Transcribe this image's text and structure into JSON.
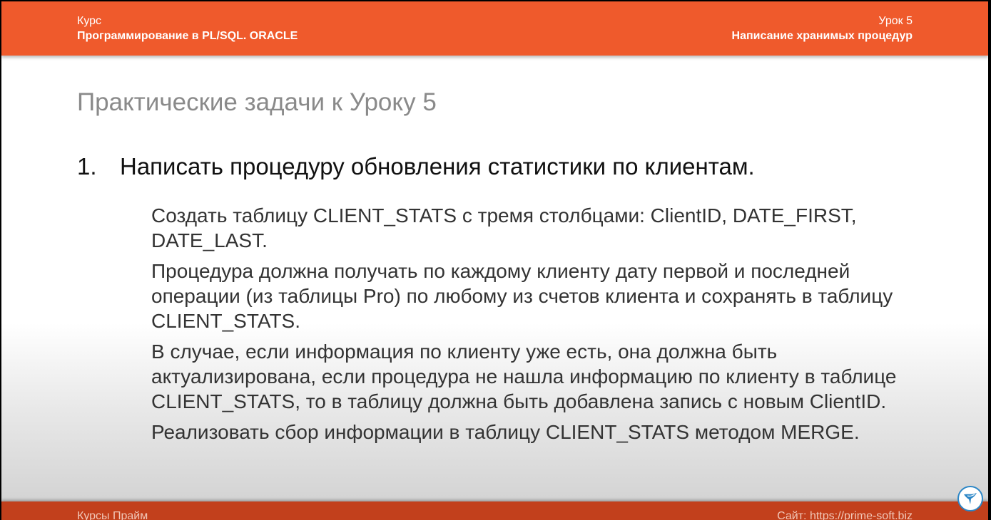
{
  "header": {
    "left_label": "Курс",
    "left_title": "Программирование в PL/SQL. ORACLE",
    "right_label": "Урок 5",
    "right_title": "Написание хранимых процедур"
  },
  "slide": {
    "title": "Практические задачи к Уроку 5",
    "task": {
      "number": "1.",
      "heading": "Написать процедуру обновления статистики по клиентам.",
      "paragraphs": [
        "Создать таблицу CLIENT_STATS с тремя столбцами: ClientID, DATE_FIRST, DATE_LAST.",
        "Процедура должна получать по каждому клиенту дату первой и последней операции (из таблицы Pro) по любому из счетов клиента и сохранять в таблицу CLIENT_STATS.",
        "В случае, если информация по клиенту уже есть, она должна быть актуализирована, если процедура не нашла информацию по клиенту в таблице CLIENT_STATS, то в таблицу должна быть добавлена запись с новым ClientID.",
        "Реализовать сбор информации в таблицу CLIENT_STATS методом MERGE."
      ]
    }
  },
  "footer": {
    "left": "Курсы Прайм",
    "right": "Сайт: https://prime-soft.biz"
  },
  "colors": {
    "header": "#ef5a2c",
    "footer": "#c2401c",
    "badge": "#2b86c6"
  },
  "icons": {
    "corner_badge": "bird-logo-icon"
  }
}
